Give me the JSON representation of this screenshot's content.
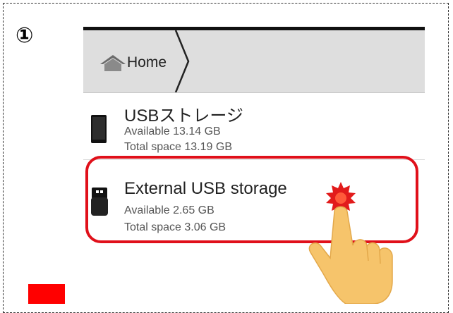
{
  "step_marker": "①",
  "header": {
    "breadcrumb_label": "Home"
  },
  "storage_list": [
    {
      "title": "USBストレージ",
      "available": "Available 13.14 GB",
      "total": "Total space 13.19 GB",
      "icon": "phone-storage-icon"
    },
    {
      "title": "External USB storage",
      "available": "Available 2.65 GB",
      "total": "Total space 3.06 GB",
      "icon": "usb-drive-icon"
    }
  ],
  "colors": {
    "highlight": "#e0101a",
    "tap_marker": "#ff0000",
    "hand": "#f6c46b",
    "actionbar": "#dedede"
  }
}
